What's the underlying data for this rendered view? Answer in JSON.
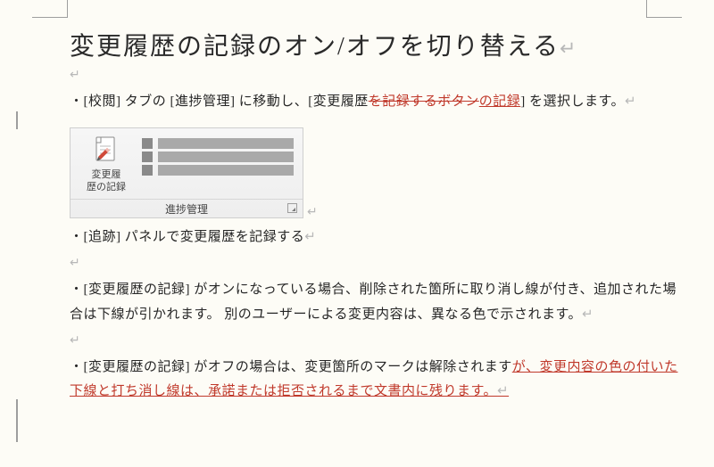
{
  "title": "変更履歴の記録のオン/オフを切り替える",
  "return_glyph": "↵",
  "p1": {
    "before": "・[校閲] タブの [進捗管理] に移動し、[変更履歴",
    "deleted": "を記録するボタン",
    "inserted": "の記録",
    "after": "] を選択します。"
  },
  "ribbon": {
    "button_label_line1": "変更履",
    "button_label_line2": "歴の記録",
    "group_label": "進捗管理"
  },
  "p2": "・[追跡]  パネルで変更履歴を記録する",
  "p3": "・[変更履歴の記録] がオンになっている場合、削除された箇所に取り消し線が付き、追加された場合は下線が引かれます。 別のユーザーによる変更内容は、異なる色で示されます。",
  "p4": {
    "before": "・[変更履歴の記録] がオフの場合は、変更箇所のマークは解除されます",
    "inserted": "が、変更内容の色の付いた下線と打ち消し線は、承諾または拒否されるまで文書内に残ります。",
    "after": ""
  }
}
